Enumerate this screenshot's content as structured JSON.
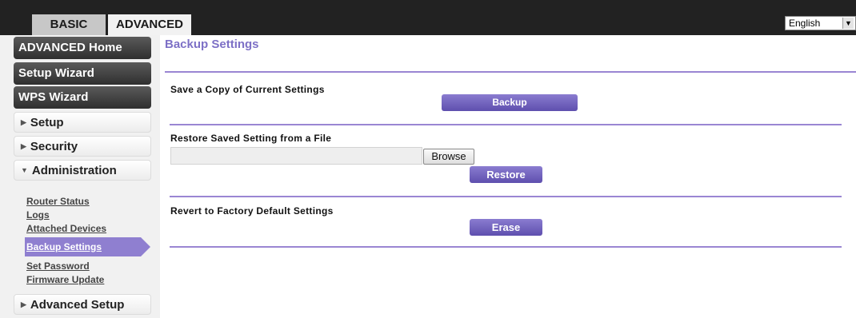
{
  "top_tabs": {
    "basic": "BASIC",
    "advanced": "ADVANCED"
  },
  "language": {
    "selected": "English"
  },
  "sidebar": {
    "advanced_home": "ADVANCED Home",
    "setup_wizard": "Setup Wizard",
    "wps_wizard": "WPS Wizard",
    "setup": "Setup",
    "security": "Security",
    "administration": "Administration",
    "admin_links": [
      "Router Status",
      "Logs",
      "Attached Devices",
      "Backup Settings",
      "Set Password",
      "Firmware Update"
    ],
    "advanced_setup": "Advanced Setup"
  },
  "main": {
    "title": "Backup Settings",
    "save_section": {
      "label": "Save a Copy of Current Settings",
      "button": "Backup"
    },
    "restore_section": {
      "label": "Restore Saved Setting from a File",
      "file_value": "",
      "browse": "Browse",
      "button": "Restore"
    },
    "revert_section": {
      "label": "Revert to Factory Default Settings",
      "button": "Erase"
    }
  },
  "colors": {
    "accent": "#8f7fd0",
    "title": "#7d70c6",
    "topbar": "#222222"
  }
}
